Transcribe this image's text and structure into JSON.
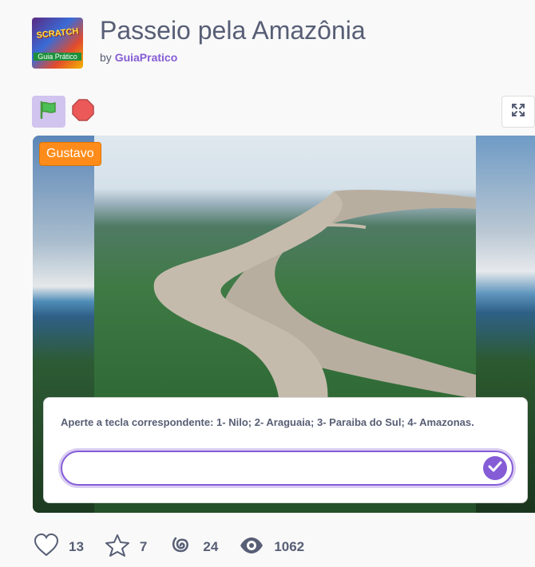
{
  "project": {
    "title": "Passeio pela Amazônia",
    "by_label": "by",
    "author": "GuiaPratico",
    "thumbnail_text": [
      "SCRATCH",
      "Guia Prático"
    ]
  },
  "controls": {
    "flag_icon": "green-flag-icon",
    "stop_icon": "stop-icon",
    "fullscreen_icon": "fullscreen-icon"
  },
  "stage": {
    "sprite_name": "Gustavo",
    "ask": {
      "question": "Aperte a tecla correspondente: 1- Nilo; 2- Araguaia; 3- Paraiba do Sul; 4- Amazonas.",
      "answer_value": ""
    }
  },
  "stats": {
    "loves": "13",
    "favorites": "7",
    "remixes": "24",
    "views": "1062"
  },
  "colors": {
    "accent": "#855cd6",
    "flag_bg": "#d1c4ee",
    "sprite_label": "#ff8c1a",
    "stop": "#ec5959"
  }
}
